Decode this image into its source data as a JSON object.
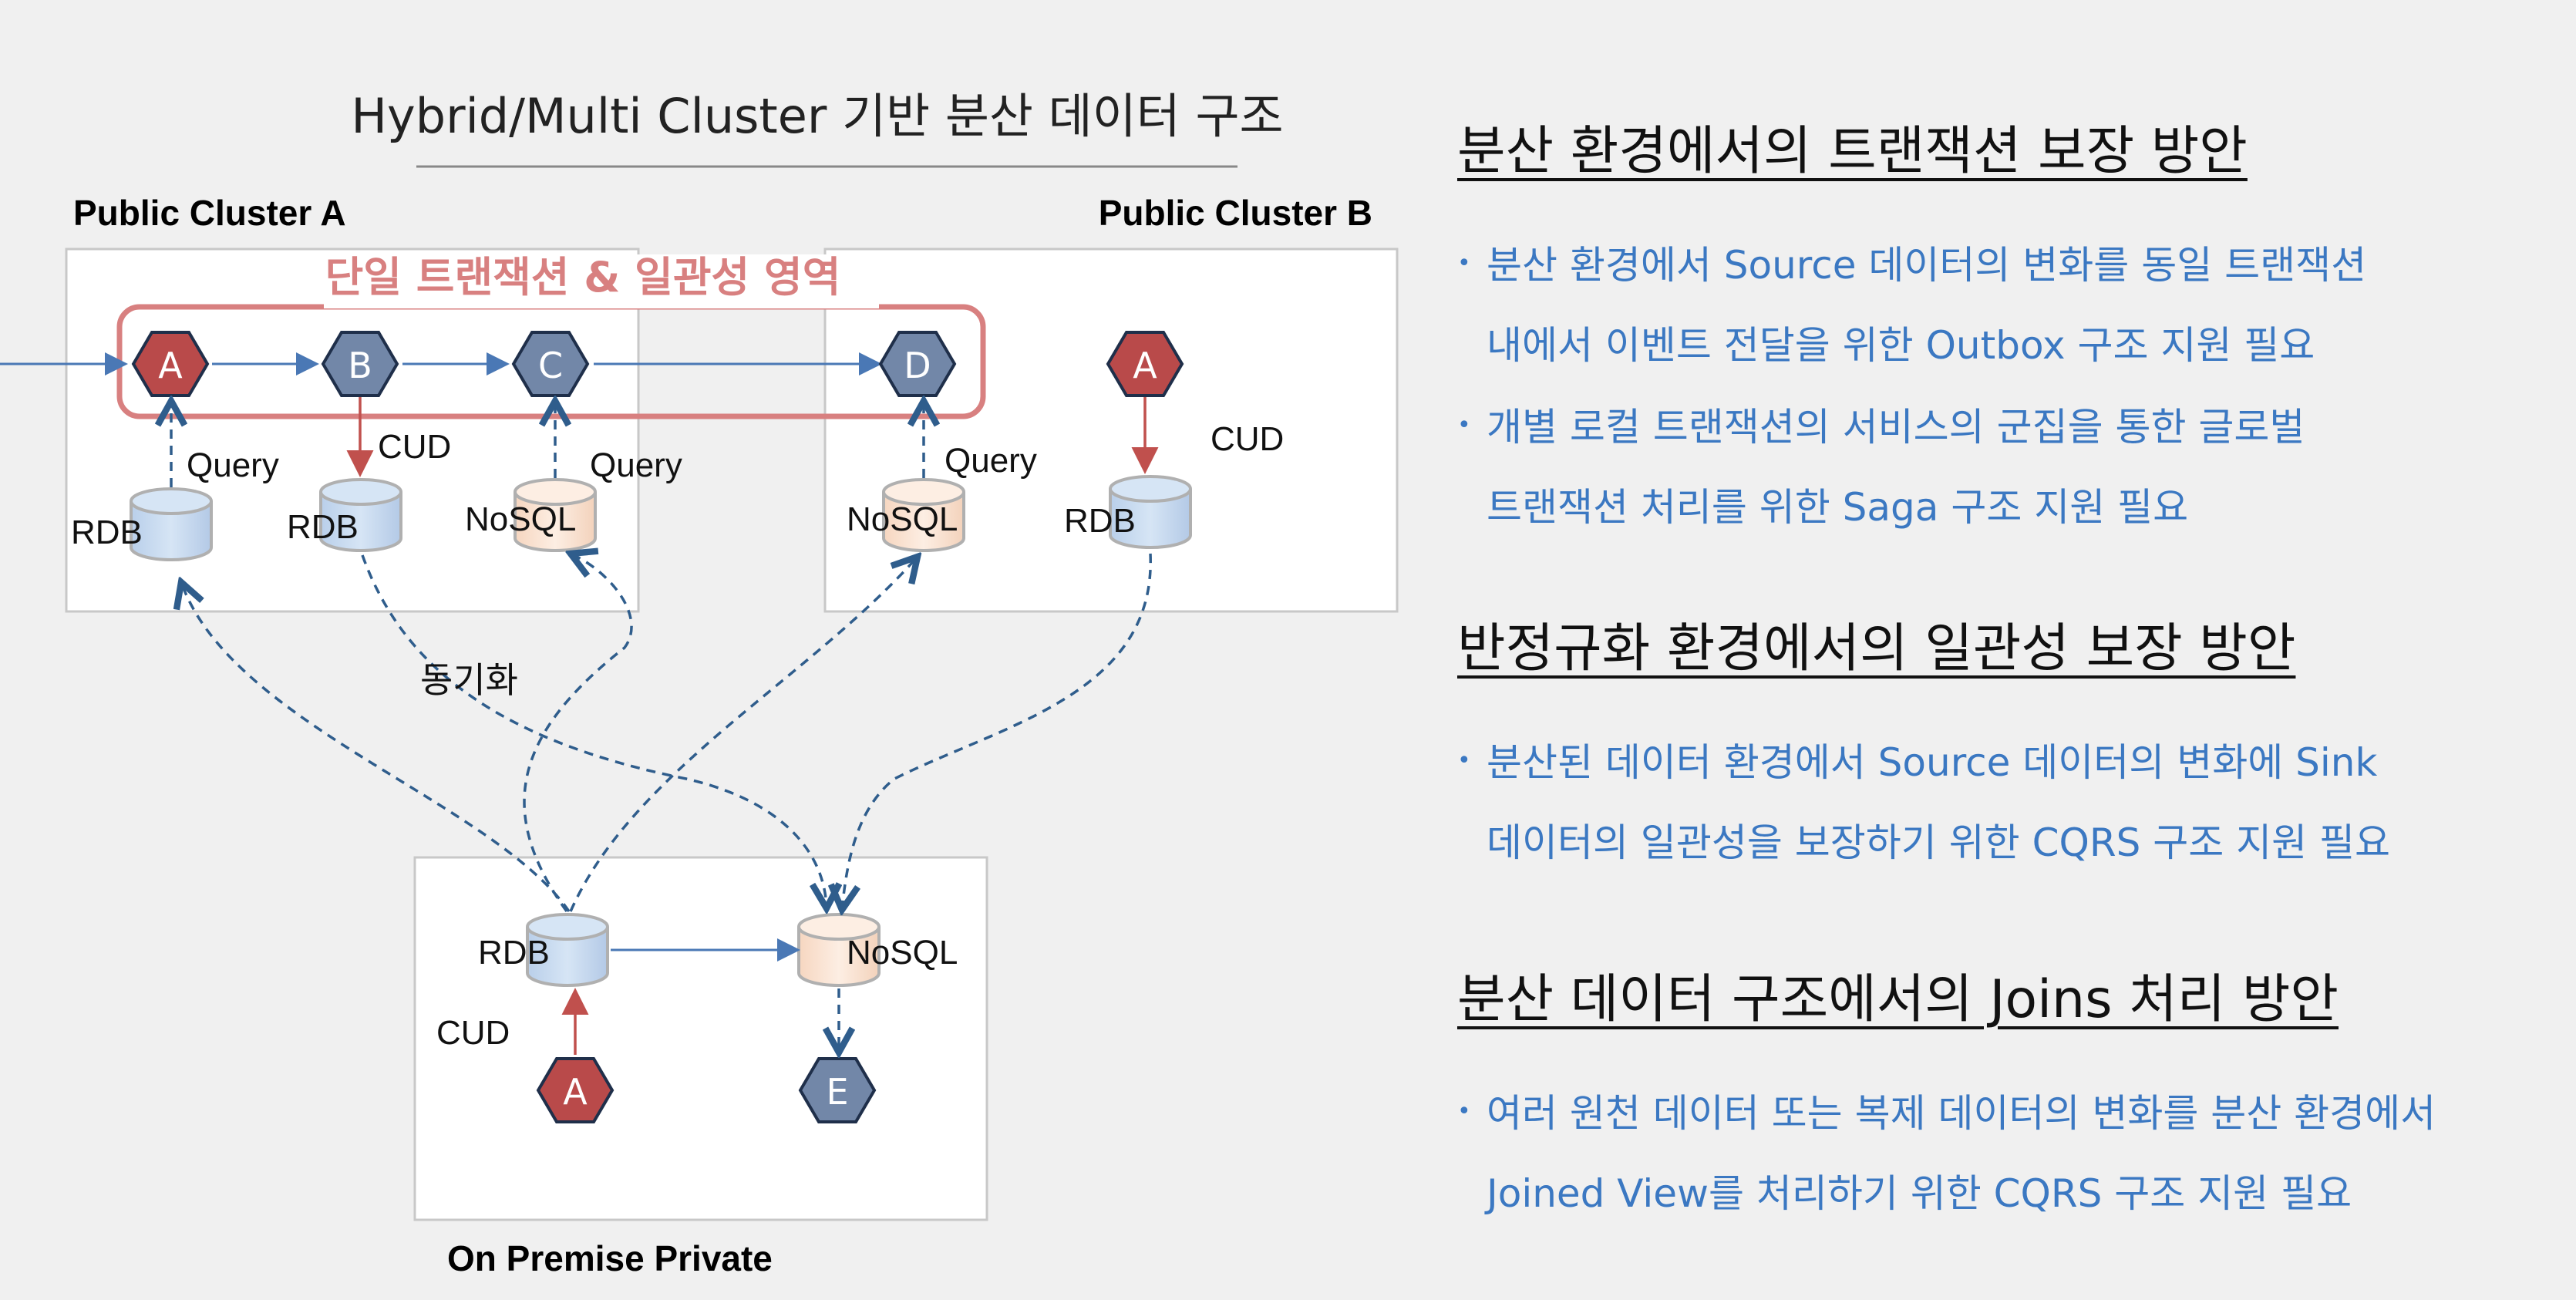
{
  "diagram": {
    "title": "Hybrid/Multi Cluster 기반 분산 데이터 구조",
    "clusters": {
      "public_a": "Public Cluster A",
      "public_b": "Public Cluster B",
      "on_premise": "On Premise Private"
    },
    "transaction_zone_label": "단일 트랜잭션 & 일관성 영역",
    "services": {
      "a1": "A",
      "b": "B",
      "c": "C",
      "d": "D",
      "a2": "A",
      "a3": "A",
      "e": "E"
    },
    "stores": {
      "rdb_a1": "RDB",
      "rdb_a2": "RDB",
      "nosql_a": "NoSQL",
      "nosql_b": "NoSQL",
      "rdb_b": "RDB",
      "rdb_op": "RDB",
      "nosql_op": "NoSQL"
    },
    "edge_labels": {
      "query_a1": "Query",
      "cud_b": "CUD",
      "query_c": "Query",
      "query_d": "Query",
      "cud_a2": "CUD",
      "sync": "동기화",
      "cud_op": "CUD"
    },
    "colors": {
      "red_hex": "#b94a4a",
      "blue_hex": "#7287a8",
      "rdb_fill": "#c9dcf1",
      "nosql_fill": "#fbe5d4",
      "zone_red": "#d88080",
      "line_blue": "#4a78b5",
      "dash_blue": "#2f5d8c",
      "arrow_red": "#c0504d"
    }
  },
  "sections": [
    {
      "title": "분산 환경에서의 트랜잭션 보장 방안",
      "bullets": [
        {
          "line1": "분산 환경에서 Source 데이터의 변화를 동일 트랜잭션",
          "line2": "내에서 이벤트 전달을 위한 Outbox 구조 지원 필요"
        },
        {
          "line1": "개별 로컬 트랜잭션의 서비스의 군집을 통한 글로벌",
          "line2": "트랜잭션 처리를 위한 Saga 구조 지원 필요"
        }
      ]
    },
    {
      "title": "반정규화 환경에서의 일관성 보장 방안",
      "bullets": [
        {
          "line1": "분산된 데이터 환경에서 Source 데이터의 변화에 Sink",
          "line2": "데이터의 일관성을 보장하기 위한 CQRS 구조 지원 필요"
        }
      ]
    },
    {
      "title": "분산 데이터 구조에서의 Joins 처리 방안",
      "bullets": [
        {
          "line1": "여러 원천 데이터 또는 복제 데이터의 변화를 분산 환경에서",
          "line2": "Joined View를 처리하기 위한 CQRS 구조 지원 필요"
        }
      ]
    }
  ],
  "bullet_symbol": "•"
}
